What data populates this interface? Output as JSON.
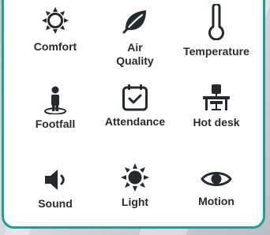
{
  "colors": {
    "icon": "#232b30",
    "label": "#2b2b2b",
    "border": "#1d9f9a",
    "card": "#ffffff"
  },
  "tiles": [
    {
      "label": "Comfort",
      "icon": "sun-icon"
    },
    {
      "label": "Air\nQuality",
      "icon": "leaf-icon"
    },
    {
      "label": "Temperature",
      "icon": "thermometer-icon"
    },
    {
      "label": "Footfall",
      "icon": "person-icon"
    },
    {
      "label": "Attendance",
      "icon": "calendar-check-icon"
    },
    {
      "label": "Hot desk",
      "icon": "desk-chair-icon"
    },
    {
      "label": "Sound",
      "icon": "speaker-icon"
    },
    {
      "label": "Light",
      "icon": "bright-sun-icon"
    },
    {
      "label": "Motion",
      "icon": "eye-icon"
    }
  ]
}
